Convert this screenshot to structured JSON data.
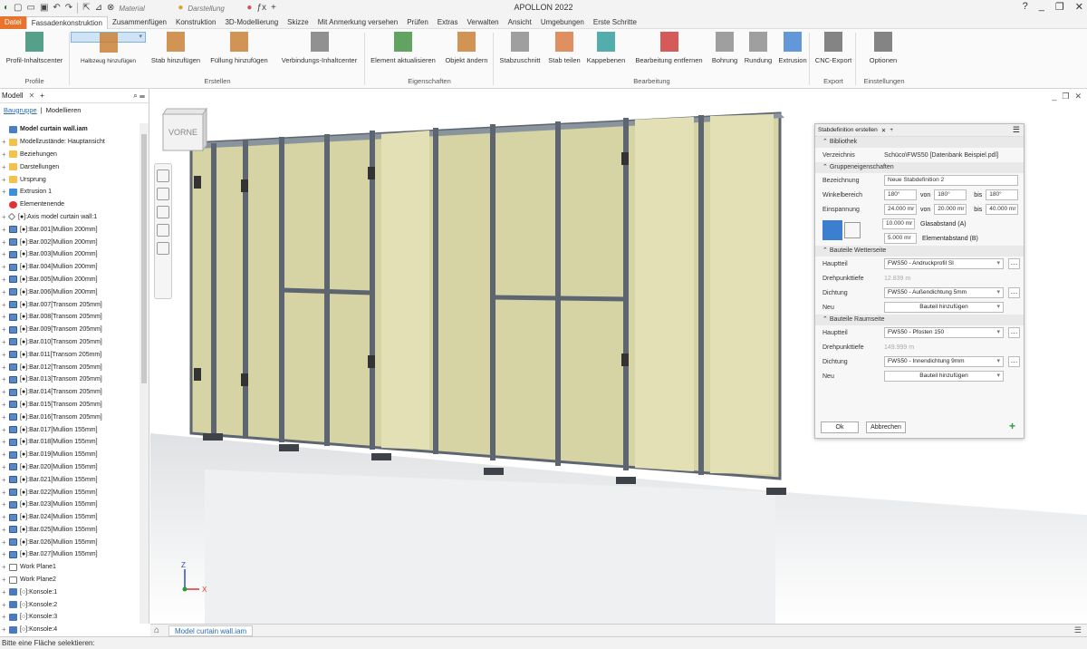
{
  "app": {
    "title": "APOLLON 2022"
  },
  "qat": {
    "material_placeholder": "Material",
    "darstellung_placeholder": "Darstellung"
  },
  "menu": [
    "Datei",
    "Fassadenkonstruktion",
    "Zusammenfügen",
    "Konstruktion",
    "3D-Modellierung",
    "Skizze",
    "Mit Anmerkung versehen",
    "Prüfen",
    "Extras",
    "Verwalten",
    "Ansicht",
    "Umgebungen",
    "Erste Schritte"
  ],
  "ribbon": {
    "buttons": [
      {
        "label": "Profil-Inhaltscenter"
      },
      {
        "label": "Halbzeug hinzufügen"
      },
      {
        "label": "Stab hinzufügen"
      },
      {
        "label": "Füllung hinzufügen"
      },
      {
        "label": "Verbindungs-Inhaltcenter"
      },
      {
        "label": "Element aktualisieren"
      },
      {
        "label": "Objekt ändern"
      },
      {
        "label": "Stabzuschnitt"
      },
      {
        "label": "Stab teilen"
      },
      {
        "label": "Kappebenen"
      },
      {
        "label": "Bearbeitung entfernen"
      },
      {
        "label": "Bohrung"
      },
      {
        "label": "Rundung"
      },
      {
        "label": "Extrusion"
      },
      {
        "label": "CNC-Export"
      },
      {
        "label": "Optionen"
      }
    ],
    "groups": [
      "Profile",
      "Erstellen",
      "Eigenschaften",
      "Bearbeitung",
      "Export",
      "Einstellungen"
    ]
  },
  "browser": {
    "tab": "Modell",
    "sub_tabs": [
      "Baugruppe",
      "Modellieren"
    ],
    "items": [
      {
        "label": "Model curtain wall.iam",
        "icon": "assembly-icon",
        "root": true
      },
      {
        "label": "Modellzustände: Hauptansicht",
        "icon": "folder-icon"
      },
      {
        "label": "Beziehungen",
        "icon": "folder-icon"
      },
      {
        "label": "Darstellungen",
        "icon": "folder-icon"
      },
      {
        "label": "Ursprung",
        "icon": "folder-icon"
      },
      {
        "label": "Extrusion 1",
        "icon": "extrusion-icon"
      },
      {
        "label": "Elementenende",
        "icon": "error-icon"
      },
      {
        "label": "[●]:Axis model curtain wall:1",
        "icon": "axis-icon"
      },
      {
        "label": "[●]:Bar.001[Mullion 200mm]",
        "icon": "bar-icon"
      },
      {
        "label": "[●]:Bar.002[Mullion 200mm]",
        "icon": "bar-icon"
      },
      {
        "label": "[●]:Bar.003[Mullion 200mm]",
        "icon": "bar-icon"
      },
      {
        "label": "[●]:Bar.004[Mullion 200mm]",
        "icon": "bar-icon"
      },
      {
        "label": "[●]:Bar.005[Mullion 200mm]",
        "icon": "bar-icon"
      },
      {
        "label": "[●]:Bar.006[Mullion 200mm]",
        "icon": "bar-icon"
      },
      {
        "label": "[●]:Bar.007[Transom 205mm]",
        "icon": "bar-icon"
      },
      {
        "label": "[●]:Bar.008[Transom 205mm]",
        "icon": "bar-icon"
      },
      {
        "label": "[●]:Bar.009[Transom 205mm]",
        "icon": "bar-icon"
      },
      {
        "label": "[●]:Bar.010[Transom 205mm]",
        "icon": "bar-icon"
      },
      {
        "label": "[●]:Bar.011[Transom 205mm]",
        "icon": "bar-icon"
      },
      {
        "label": "[●]:Bar.012[Transom 205mm]",
        "icon": "bar-icon"
      },
      {
        "label": "[●]:Bar.013[Transom 205mm]",
        "icon": "bar-icon"
      },
      {
        "label": "[●]:Bar.014[Transom 205mm]",
        "icon": "bar-icon"
      },
      {
        "label": "[●]:Bar.015[Transom 205mm]",
        "icon": "bar-icon"
      },
      {
        "label": "[●]:Bar.016[Transom 205mm]",
        "icon": "bar-icon"
      },
      {
        "label": "[●]:Bar.017[Mullion 155mm]",
        "icon": "bar-icon"
      },
      {
        "label": "[●]:Bar.018[Mullion 155mm]",
        "icon": "bar-icon"
      },
      {
        "label": "[●]:Bar.019[Mullion 155mm]",
        "icon": "bar-icon"
      },
      {
        "label": "[●]:Bar.020[Mullion 155mm]",
        "icon": "bar-icon"
      },
      {
        "label": "[●]:Bar.021[Mullion 155mm]",
        "icon": "bar-icon"
      },
      {
        "label": "[●]:Bar.022[Mullion 155mm]",
        "icon": "bar-icon"
      },
      {
        "label": "[●]:Bar.023[Mullion 155mm]",
        "icon": "bar-icon"
      },
      {
        "label": "[●]:Bar.024[Mullion 155mm]",
        "icon": "bar-icon"
      },
      {
        "label": "[●]:Bar.025[Mullion 155mm]",
        "icon": "bar-icon"
      },
      {
        "label": "[●]:Bar.026[Mullion 155mm]",
        "icon": "bar-icon"
      },
      {
        "label": "[●]:Bar.027[Mullion 155mm]",
        "icon": "bar-icon"
      },
      {
        "label": "Work Plane1",
        "icon": "workplane-icon"
      },
      {
        "label": "Work Plane2",
        "icon": "workplane-icon"
      },
      {
        "label": "[○]:Konsole:1",
        "icon": "konsole-icon"
      },
      {
        "label": "[○]:Konsole:2",
        "icon": "konsole-icon"
      },
      {
        "label": "[○]:Konsole:3",
        "icon": "konsole-icon"
      },
      {
        "label": "[○]:Konsole:4",
        "icon": "konsole-icon"
      }
    ]
  },
  "viewcube": {
    "label": "VORNE"
  },
  "axes": {
    "z": "Z",
    "x": "X"
  },
  "dialog": {
    "tab": "Stabdefinition erstellen",
    "sec_bibliothek": "Bibliothek",
    "verzeichnis_label": "Verzeichnis",
    "verzeichnis_value": "Schüco\\FWS50 [Datenbank Beispiel.pdl]",
    "sec_gruppe": "Gruppeneigenschaften",
    "bezeichnung_label": "Bezeichnung",
    "bezeichnung_value": "Neue Stabdefinition 2",
    "winkel_label": "Winkelbereich",
    "winkel_value": "180°",
    "von_label": "von",
    "winkel_von": "180°",
    "bis_label": "bis",
    "winkel_bis": "180°",
    "einspannung_label": "Einspannung",
    "einspannung_value": "24.000 mr",
    "einspannung_von": "20.000 mr",
    "einspannung_bis": "40.000 mr",
    "glasabstand_value": "10.000 mr",
    "glasabstand_label": "Glasabstand (A)",
    "elementabstand_value": "5.000 mr",
    "elementabstand_label": "Elementabstand (B)",
    "sec_wetter": "Bauteile Wetterseite",
    "hauptteil_label": "Hauptteil",
    "wetter_hauptteil": "FWS50 - Andruckprofil SI",
    "drehpunkt_label": "Drehpunkttiefe",
    "wetter_drehpunkt": "12.839 m",
    "dichtung_label": "Dichtung",
    "wetter_dichtung": "FWS50 - Außendichtung 5mm",
    "neu_label": "Neu",
    "bauteil_hinzu": "Bauteil hinzufügen",
    "sec_raum": "Bauteile Raumseite",
    "raum_hauptteil": "FWS50 - Pfosten 150",
    "raum_drehpunkt": "149.999 m",
    "raum_dichtung": "FWS50 - Innendichtung 9mm",
    "ok": "Ok",
    "abbrechen": "Abbrechen"
  },
  "doc_tab": "Model curtain wall.iam",
  "status": "Bitte eine Fläche selektieren:",
  "colors": {
    "accent_orange": "#e8742b",
    "selection_blue": "#cfe3f7",
    "glass": "#d8d6a8",
    "frame": "#6e7c88"
  }
}
